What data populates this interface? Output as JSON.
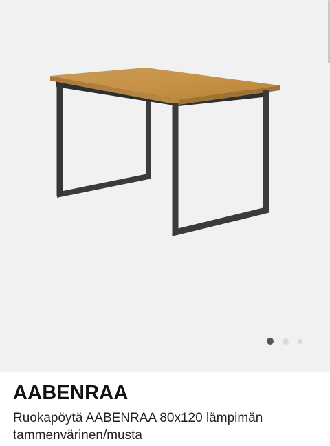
{
  "product": {
    "name": "AABENRAA",
    "description": "Ruokapöytä AABENRAA 80x120 lämpimän tammenvärinen/musta"
  },
  "gallery": {
    "image_icon": "dining-table-image",
    "slide_count": 3,
    "active_slide": 1
  },
  "colors": {
    "background": "#ffffff",
    "gallery_bg": "#f1f1f1",
    "tabletop": "#c9974d",
    "frame": "#3a3b3d",
    "dot_active": "#555555",
    "dot_inactive": "#d9d9d9"
  }
}
